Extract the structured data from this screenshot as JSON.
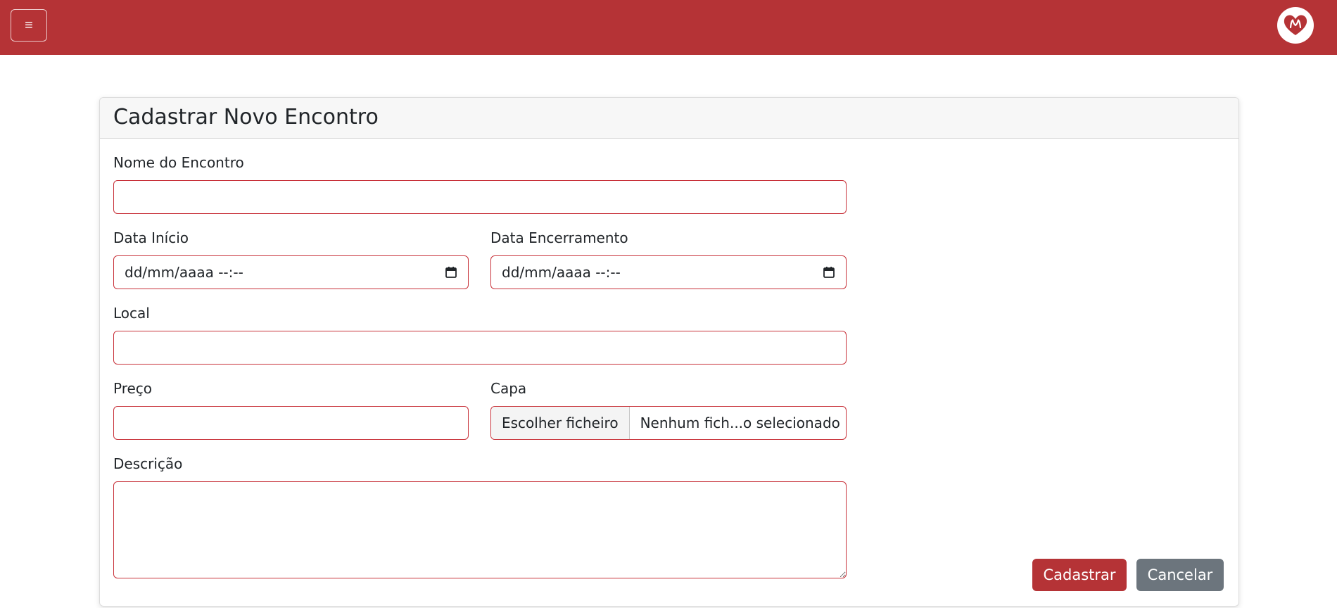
{
  "navbar": {
    "menu_icon": "≡",
    "brand_color": "#b53336"
  },
  "form": {
    "title": "Cadastrar Novo Encontro",
    "nome_label": "Nome do Encontro",
    "nome_value": "",
    "data_inicio_label": "Data Início",
    "data_inicio_placeholder": "dd/mm/aaaa --:--",
    "data_encerramento_label": "Data Encerramento",
    "data_encerramento_placeholder": "dd/mm/aaaa --:--",
    "local_label": "Local",
    "local_value": "",
    "preco_label": "Preço",
    "preco_value": "",
    "capa_label": "Capa",
    "capa_button": "Escolher ficheiro",
    "capa_status": "Nenhum fich...o selecionado",
    "descricao_label": "Descrição",
    "descricao_value": ""
  },
  "actions": {
    "submit": "Cadastrar",
    "cancel": "Cancelar"
  },
  "colors": {
    "accent": "#b53336",
    "secondary": "#6c757d",
    "field_border": "#c8323a"
  }
}
